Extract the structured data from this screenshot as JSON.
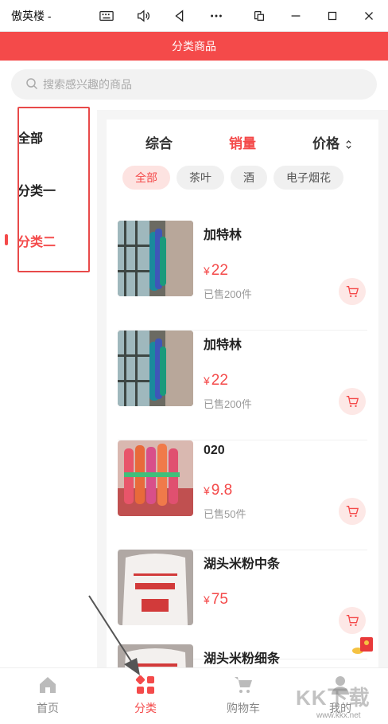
{
  "window": {
    "title": "傲英楼 -"
  },
  "header": {
    "title": "分类商品"
  },
  "search": {
    "placeholder": "搜索感兴趣的商品"
  },
  "sidebar": {
    "items": [
      {
        "label": "全部",
        "active": false
      },
      {
        "label": "分类一",
        "active": false
      },
      {
        "label": "分类二",
        "active": true
      }
    ]
  },
  "sort": {
    "options": [
      {
        "label": "综合",
        "active": false
      },
      {
        "label": "销量",
        "active": true
      },
      {
        "label": "价格",
        "active": false
      }
    ]
  },
  "filters": [
    {
      "label": "全部",
      "active": true
    },
    {
      "label": "茶叶",
      "active": false
    },
    {
      "label": "酒",
      "active": false
    },
    {
      "label": "电子烟花",
      "active": false
    }
  ],
  "currency": "¥",
  "products": [
    {
      "name": "加特林",
      "price": "22",
      "sold": "已售200件"
    },
    {
      "name": "加特林",
      "price": "22",
      "sold": "已售200件"
    },
    {
      "name": "020",
      "price": "9.8",
      "sold": "已售50件"
    },
    {
      "name": "湖头米粉中条",
      "price": "75",
      "sold": ""
    },
    {
      "name": "湖头米粉细条",
      "price": "",
      "sold": ""
    }
  ],
  "tabs": [
    {
      "label": "首页",
      "icon": "home-icon",
      "active": false
    },
    {
      "label": "分类",
      "icon": "category-icon",
      "active": true
    },
    {
      "label": "购物车",
      "icon": "cart-icon",
      "active": false
    },
    {
      "label": "我的",
      "icon": "user-icon",
      "active": false
    }
  ],
  "watermark": {
    "text": "KK下载",
    "url": "www.kkx.net"
  },
  "colors": {
    "accent": "#f44a4a",
    "chip_active_bg": "#fde3e1"
  }
}
